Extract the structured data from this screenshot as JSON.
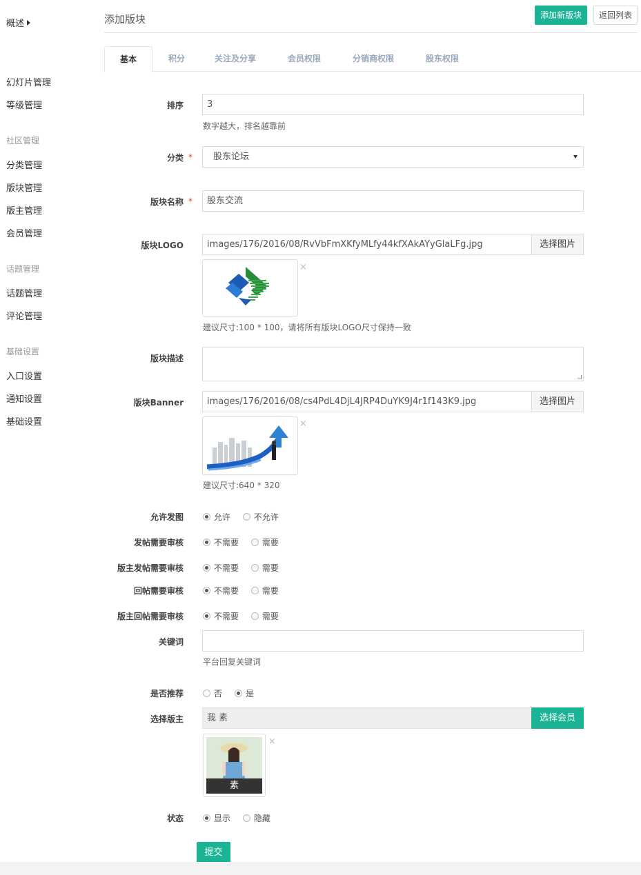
{
  "sidebar": {
    "overview": "概述",
    "items": [
      {
        "label": "幻灯片管理",
        "type": "item"
      },
      {
        "label": "等级管理",
        "type": "item"
      },
      {
        "label": "社区管理",
        "type": "group"
      },
      {
        "label": "分类管理",
        "type": "item"
      },
      {
        "label": "版块管理",
        "type": "item"
      },
      {
        "label": "版主管理",
        "type": "item"
      },
      {
        "label": "会员管理",
        "type": "item"
      },
      {
        "label": "话题管理",
        "type": "group"
      },
      {
        "label": "话题管理",
        "type": "item"
      },
      {
        "label": "评论管理",
        "type": "item"
      },
      {
        "label": "基础设置",
        "type": "group"
      },
      {
        "label": "入口设置",
        "type": "item"
      },
      {
        "label": "通知设置",
        "type": "item"
      },
      {
        "label": "基础设置",
        "type": "item"
      }
    ]
  },
  "header": {
    "title": "添加版块",
    "add_button": "添加新版块",
    "back_button": "返回列表"
  },
  "tabs": [
    "基本",
    "积分",
    "关注及分享",
    "会员权限",
    "分销商权限",
    "股东权限"
  ],
  "form": {
    "sort": {
      "label": "排序",
      "value": "3",
      "help": "数字越大，排名越靠前"
    },
    "category": {
      "label": "分类",
      "required": "*",
      "value": "股东论坛"
    },
    "name": {
      "label": "版块名称",
      "required": "*",
      "value": "股东交流"
    },
    "logo": {
      "label": "版块LOGO",
      "value": "images/176/2016/08/RvVbFmXKfyMLfy44kfXAkAYyGlaLFg.jpg",
      "button": "选择图片",
      "help": "建议尺寸:100 * 100，请将所有版块LOGO尺寸保持一致",
      "remove": "×"
    },
    "desc": {
      "label": "版块描述",
      "value": ""
    },
    "banner": {
      "label": "版块Banner",
      "value": "images/176/2016/08/cs4PdL4DjL4JRP4DuYK9J4r1f143K9.jpg",
      "button": "选择图片",
      "help": "建议尺寸:640 * 320",
      "remove": "×"
    },
    "allow_image": {
      "label": "允许发图",
      "options": [
        "允许",
        "不允许"
      ]
    },
    "post_review": {
      "label": "发帖需要审核",
      "options": [
        "不需要",
        "需要"
      ]
    },
    "mod_post_review": {
      "label": "版主发帖需要审核",
      "options": [
        "不需要",
        "需要"
      ]
    },
    "reply_review": {
      "label": "回帖需要审核",
      "options": [
        "不需要",
        "需要"
      ]
    },
    "mod_reply_review": {
      "label": "版主回帖需要审核",
      "options": [
        "不需要",
        "需要"
      ]
    },
    "keywords": {
      "label": "关键词",
      "value": "",
      "help": "平台回复关键词"
    },
    "recommend": {
      "label": "是否推荐",
      "options": [
        "否",
        "是"
      ]
    },
    "moderator": {
      "label": "选择版主",
      "value": "我 素",
      "button": "选择会员",
      "avatar_caption": "素",
      "remove": "×"
    },
    "status": {
      "label": "状态",
      "options": [
        "显示",
        "隐藏"
      ]
    },
    "submit": "提交"
  },
  "colors": {
    "accent": "#1ab394",
    "required": "#ee3333"
  }
}
